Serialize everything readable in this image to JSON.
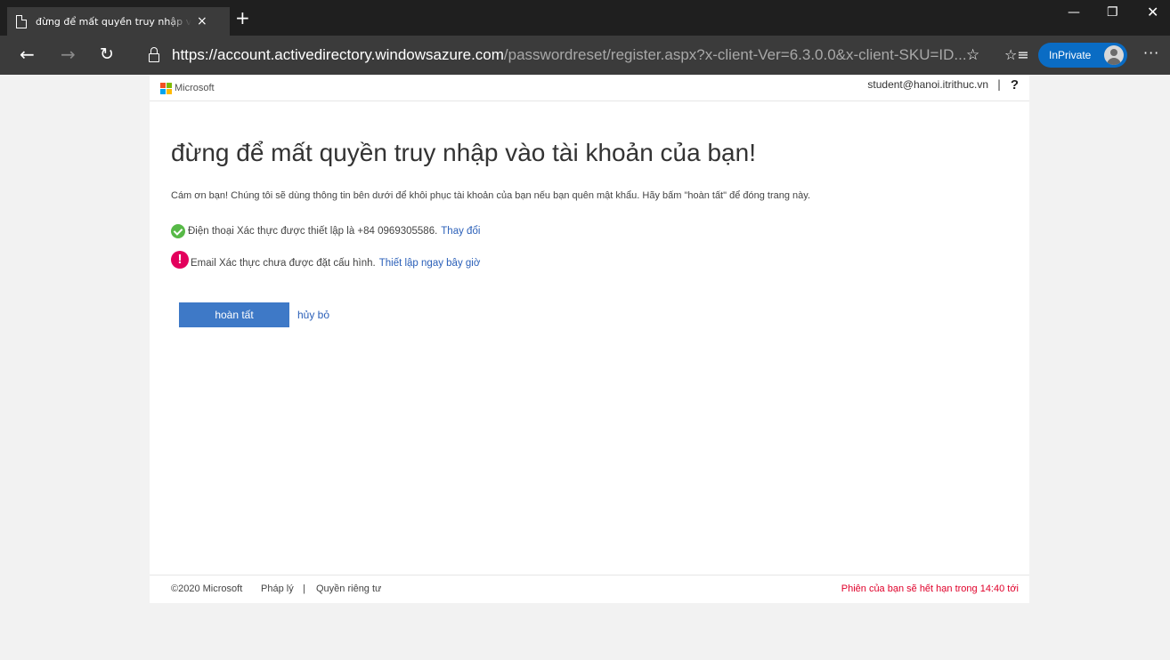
{
  "browser": {
    "tab_title": "đừng để mất quyền truy nhập vào tài khoản của bạn!",
    "tab_close": "×",
    "new_tab": "+",
    "url_host": "https://account.activedirectory.windowsazure.com",
    "url_rest": "/passwordreset/register.aspx?x-client-Ver=6.3.0.0&x-client-SKU=ID...",
    "inprivate_label": "InPrivate",
    "icons": [
      "page-icon",
      "back-icon",
      "forward-icon",
      "refresh-icon",
      "lock-icon",
      "star-icon",
      "favorites-icon",
      "more-icon",
      "minimize-icon",
      "restore-icon",
      "close-icon"
    ]
  },
  "header": {
    "brand": "Microsoft",
    "user_email": "student@hanoi.itrithuc.vn",
    "separator": "|",
    "help": "?"
  },
  "main": {
    "title": "đừng để mất quyền truy nhập vào tài khoản của bạn!",
    "intro": "Cám ơn bạn! Chúng tôi sẽ dùng thông tin bên dưới để khôi phục tài khoản của bạn nếu bạn quên mật khẩu. Hãy bấm \"hoàn tất\" để đóng trang này.",
    "phone_text": "Điện thoại Xác thực được thiết lập là +84 0969305586.",
    "phone_link": "Thay đổi",
    "email_text": "Email Xác thực chưa được đặt cấu hình.",
    "email_link": "Thiết lập ngay bây giờ",
    "done_button": "hoàn tất",
    "cancel_link": "hủy bỏ"
  },
  "footer": {
    "copyright": "©2020 Microsoft",
    "legal": "Pháp lý",
    "separator": "|",
    "privacy": "Quyền riêng tư",
    "session": "Phiên của bạn sẽ hết hạn trong 14:40 tới"
  },
  "colors": {
    "accent": "#3e79c7",
    "link": "#2a5fb8",
    "success": "#57b947",
    "warning": "#e3005c",
    "session_text": "#e0002a"
  }
}
